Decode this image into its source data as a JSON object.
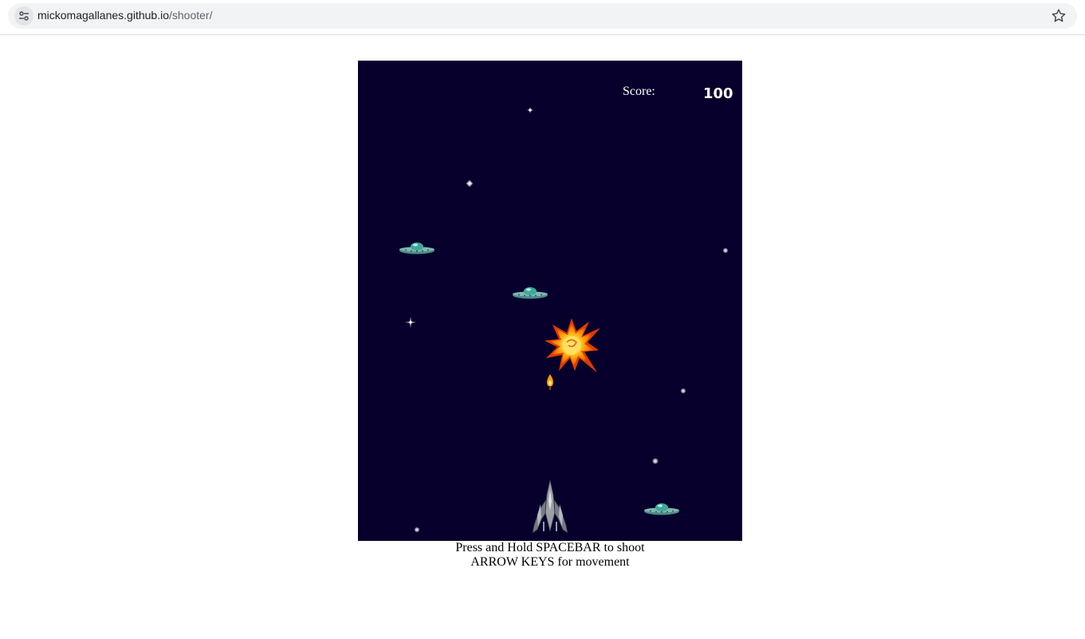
{
  "browser": {
    "url_host": "mickomagallanes.github.io",
    "url_path": "/shooter/",
    "site_info_icon": "tune-icon",
    "bookmark_icon": "star-outline-icon"
  },
  "game": {
    "background_color": "#07002d",
    "score_label": "Score:",
    "score_value": "100",
    "sprites": {
      "player": "player-spaceship",
      "enemies": "ufo-saucer",
      "explosion": "explosion",
      "bullet": "fireball-bullet",
      "stars": "star-sparkle"
    }
  },
  "instructions": {
    "line1": "Press and Hold SPACEBAR to shoot",
    "line2": "ARROW KEYS for movement"
  }
}
